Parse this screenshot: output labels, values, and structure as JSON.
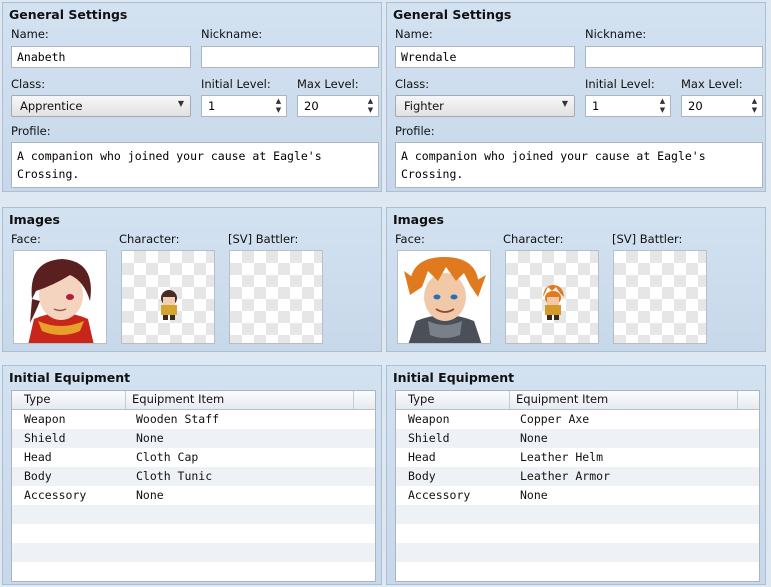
{
  "panels": [
    {
      "general": {
        "title": "General Settings",
        "name_label": "Name:",
        "name_value": "Anabeth",
        "nickname_label": "Nickname:",
        "nickname_value": "",
        "class_label": "Class:",
        "class_value": "Apprentice",
        "initial_level_label": "Initial Level:",
        "initial_level_value": "1",
        "max_level_label": "Max Level:",
        "max_level_value": "20",
        "profile_label": "Profile:",
        "profile_line1": "A companion who joined your cause at Eagle's",
        "profile_line2": "Crossing."
      },
      "images": {
        "title": "Images",
        "face_label": "Face:",
        "character_label": "Character:",
        "battler_label": "[SV] Battler:"
      },
      "equipment": {
        "title": "Initial Equipment",
        "col_type": "Type",
        "col_item": "Equipment Item",
        "rows": [
          {
            "type": "Weapon",
            "item": "Wooden Staff"
          },
          {
            "type": "Shield",
            "item": "None"
          },
          {
            "type": "Head",
            "item": "Cloth Cap"
          },
          {
            "type": "Body",
            "item": "Cloth Tunic"
          },
          {
            "type": "Accessory",
            "item": "None"
          }
        ]
      }
    },
    {
      "general": {
        "title": "General Settings",
        "name_label": "Name:",
        "name_value": "Wrendale",
        "nickname_label": "Nickname:",
        "nickname_value": "",
        "class_label": "Class:",
        "class_value": "Fighter",
        "initial_level_label": "Initial Level:",
        "initial_level_value": "1",
        "max_level_label": "Max Level:",
        "max_level_value": "20",
        "profile_label": "Profile:",
        "profile_line1": "A companion who joined your cause at Eagle's",
        "profile_line2": "Crossing."
      },
      "images": {
        "title": "Images",
        "face_label": "Face:",
        "character_label": "Character:",
        "battler_label": "[SV] Battler:"
      },
      "equipment": {
        "title": "Initial Equipment",
        "col_type": "Type",
        "col_item": "Equipment Item",
        "rows": [
          {
            "type": "Weapon",
            "item": "Copper Axe"
          },
          {
            "type": "Shield",
            "item": "None"
          },
          {
            "type": "Head",
            "item": "Leather Helm"
          },
          {
            "type": "Body",
            "item": "Leather Armor"
          },
          {
            "type": "Accessory",
            "item": "None"
          }
        ]
      }
    }
  ],
  "icons": {
    "dropdown": "chevron-down-icon",
    "spinner": "spin-arrows-icon"
  },
  "colors": {
    "panel_bg": "#c7d8ea",
    "face1_hair": "#5a1f1f",
    "face1_scarf": "#c8261b",
    "face2_hair": "#e07a1f"
  }
}
